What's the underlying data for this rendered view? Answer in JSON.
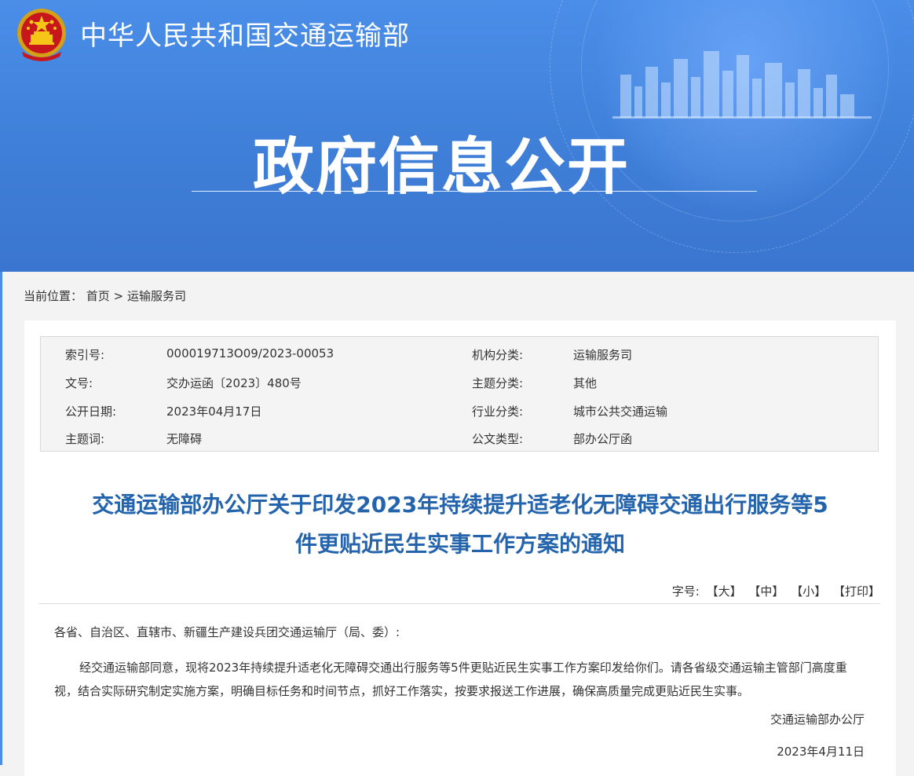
{
  "header": {
    "ministry_name": "中华人民共和国交通运输部",
    "section_title": "政府信息公开",
    "colors": {
      "banner": "#4a8ee9",
      "title_blue": "#2464ad"
    }
  },
  "breadcrumb": {
    "prefix": "当前位置：",
    "items": [
      "首页",
      "运输服务司"
    ],
    "separator": ">"
  },
  "meta": {
    "rows": [
      {
        "label1": "索引号:",
        "value1": "000019713O09/2023-00053",
        "label2": "机构分类:",
        "value2": "运输服务司"
      },
      {
        "label1": "文号:",
        "value1": "交办运函〔2023〕480号",
        "label2": "主题分类:",
        "value2": "其他"
      },
      {
        "label1": "公开日期:",
        "value1": "2023年04月17日",
        "label2": "行业分类:",
        "value2": "城市公共交通运输"
      },
      {
        "label1": "主题词:",
        "value1": "无障碍",
        "label2": "公文类型:",
        "value2": "部办公厅函"
      }
    ]
  },
  "document": {
    "title_line1": "交通运输部办公厅关于印发2023年持续提升适老化无障碍交通出行服务等5",
    "title_line2": "件更贴近民生实事工作方案的通知",
    "font_size_label": "字号:",
    "tools": [
      "【大】",
      "【中】",
      "【小】",
      "【打印】"
    ],
    "salutation": "各省、自治区、直辖市、新疆生产建设兵团交通运输厅（局、委）:",
    "paragraph": "经交通运输部同意，现将2023年持续提升适老化无障碍交通出行服务等5件更贴近民生实事工作方案印发给你们。请各省级交通运输主管部门高度重视，结合实际研究制定实施方案，明确目标任务和时间节点，抓好工作落实，按要求报送工作进展，确保高质量完成更贴近民生实事。",
    "signature": "交通运输部办公厅",
    "date": "2023年4月11日"
  }
}
